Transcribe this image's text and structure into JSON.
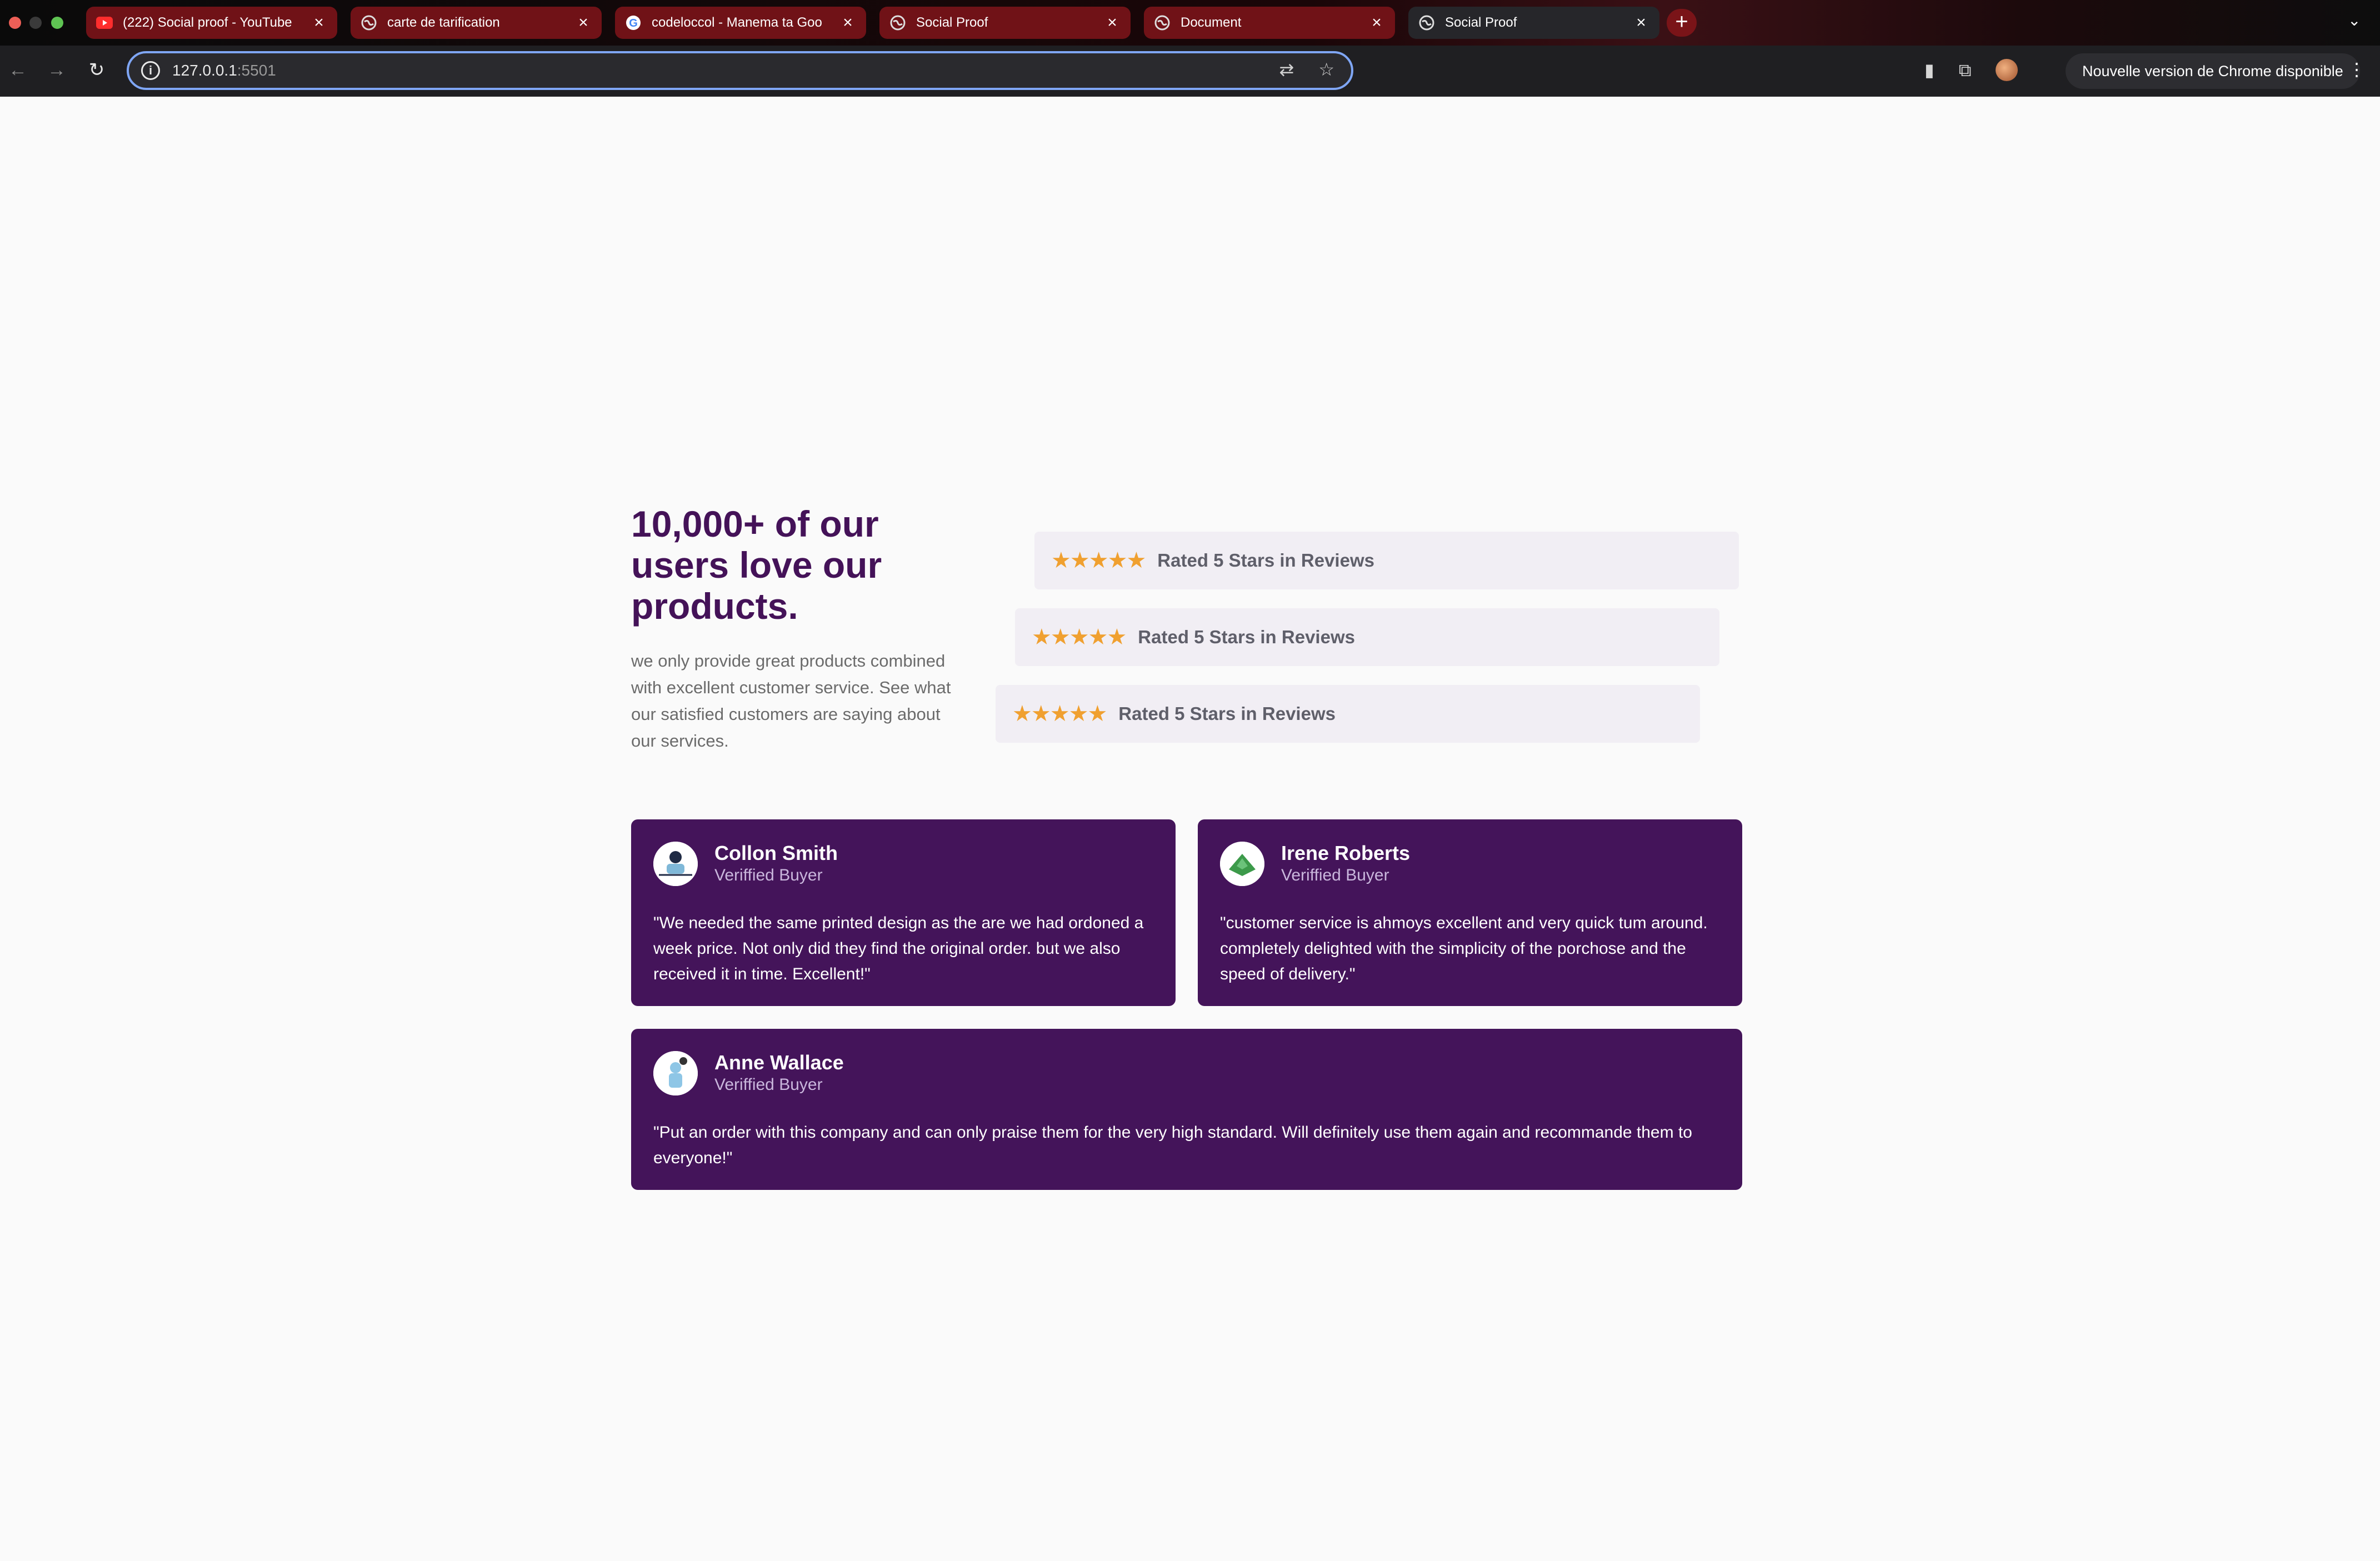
{
  "browser": {
    "tabs": [
      {
        "title": "(222) Social proof - YouTube",
        "favicon": "youtube-icon",
        "active": false
      },
      {
        "title": "carte de tarification",
        "favicon": "globe-icon",
        "active": false
      },
      {
        "title": "codeloccol - Manema ta Goo",
        "favicon": "google-icon",
        "active": false
      },
      {
        "title": "Social Proof",
        "favicon": "globe-icon",
        "active": false
      },
      {
        "title": "Document",
        "favicon": "globe-icon",
        "active": false
      },
      {
        "title": "Social Proof",
        "favicon": "globe-icon",
        "active": true
      }
    ],
    "url_host": "127.0.0.1",
    "url_port": ":5501",
    "update_label": "Nouvelle version de Chrome disponible"
  },
  "hero": {
    "title": "10,000+ of our users love our products.",
    "subtitle": "we only provide great products combined with excellent customer service. See what our satisfied customers are saying about our services."
  },
  "ratings": [
    {
      "stars": "★★★★★",
      "label": "Rated 5 Stars in Reviews"
    },
    {
      "stars": "★★★★★",
      "label": "Rated 5 Stars in Reviews"
    },
    {
      "stars": "★★★★★",
      "label": "Rated 5 Stars in Reviews"
    }
  ],
  "testimonials": [
    {
      "name": "Collon Smith",
      "role": "Veriffied Buyer",
      "quote": "\"We needed the same printed design as the are we had ordoned a week price. Not only did they find the original order. but we also received it in time. Excellent!\""
    },
    {
      "name": "Irene Roberts",
      "role": "Veriffied Buyer",
      "quote": "\"customer service is ahmoys excellent and very quick tum around. completely delighted with the simplicity of the porchose and the speed of delivery.\""
    },
    {
      "name": "Anne Wallace",
      "role": "Veriffied Buyer",
      "quote": "\"Put an order with this company and can only praise them for the very high standard. Will definitely use them again and recommande them to everyone!\""
    }
  ],
  "colors": {
    "accent": "#44145a",
    "star": "#f0a030",
    "rating_bg": "#f1eef4"
  }
}
